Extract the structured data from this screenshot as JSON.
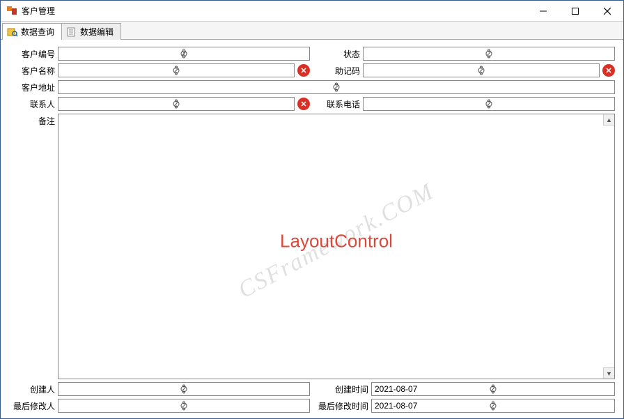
{
  "window": {
    "title": "客户管理"
  },
  "tabs": [
    {
      "label": "数据查询",
      "icon": "query-icon"
    },
    {
      "label": "数据编辑",
      "icon": "edit-icon"
    }
  ],
  "fields": {
    "customer_no": {
      "label": "客户编号",
      "value": ""
    },
    "status": {
      "label": "状态",
      "value": ""
    },
    "customer_name": {
      "label": "客户名称",
      "value": ""
    },
    "mnemonic": {
      "label": "助记码",
      "value": ""
    },
    "address": {
      "label": "客户地址",
      "value": ""
    },
    "contact": {
      "label": "联系人",
      "value": ""
    },
    "phone": {
      "label": "联系电话",
      "value": ""
    },
    "remark": {
      "label": "备注",
      "value": ""
    },
    "creator": {
      "label": "创建人",
      "value": ""
    },
    "create_time": {
      "label": "创建时间",
      "value": "2021-08-07"
    },
    "modifier": {
      "label": "最后修改人",
      "value": ""
    },
    "modify_time": {
      "label": "最后修改时间",
      "value": "2021-08-07"
    }
  },
  "overlay": {
    "text": "LayoutControl"
  },
  "watermark": {
    "text": "CSFramework.COM"
  }
}
